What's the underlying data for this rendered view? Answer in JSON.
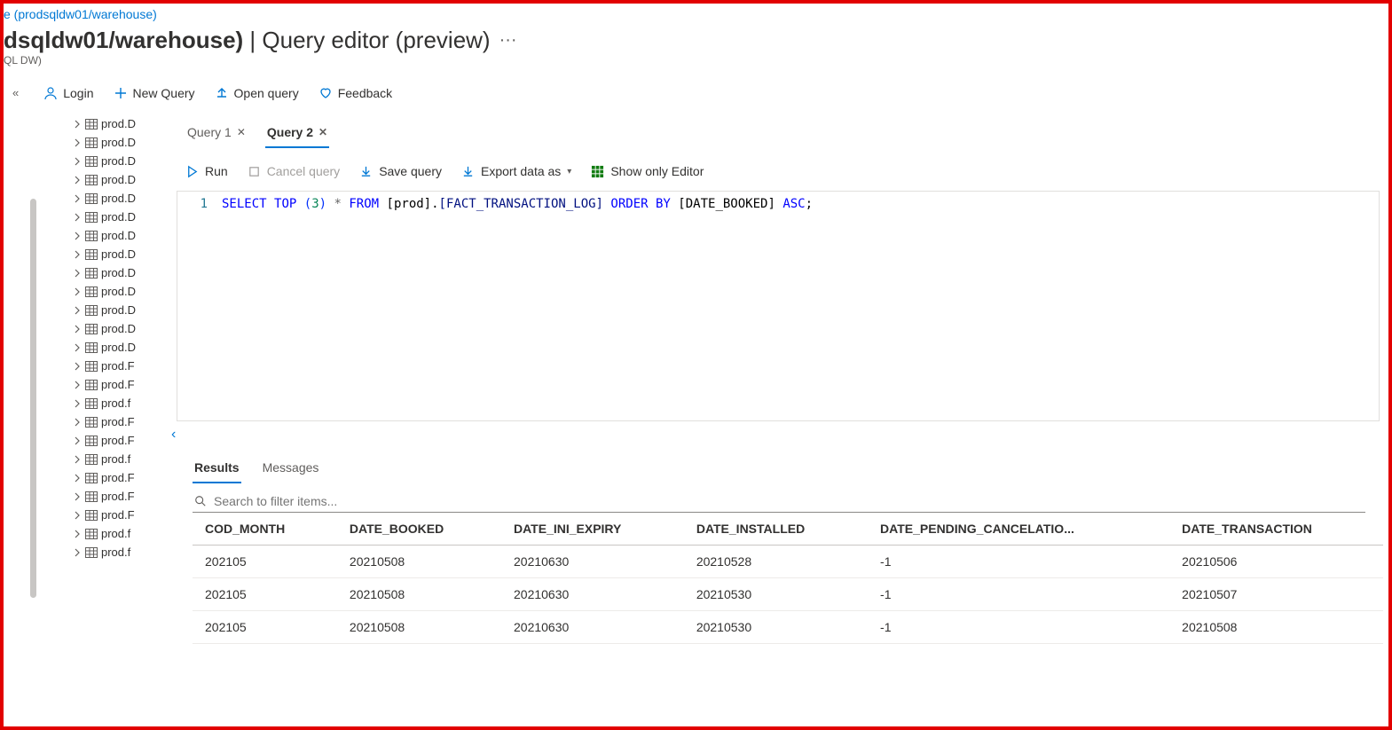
{
  "breadcrumb": {
    "link": "e (prodsqldw01/warehouse)"
  },
  "header": {
    "title_bold": "dsqldw01/warehouse)",
    "title_light": " | Query editor (preview)",
    "subtitle": "QL DW)",
    "more": "···"
  },
  "toolbar": {
    "collapse": "«",
    "login": "Login",
    "new_query": "New Query",
    "open_query": "Open query",
    "feedback": "Feedback"
  },
  "sidebar": {
    "items": [
      "prod.D",
      "prod.D",
      "prod.D",
      "prod.D",
      "prod.D",
      "prod.D",
      "prod.D",
      "prod.D",
      "prod.D",
      "prod.D",
      "prod.D",
      "prod.D",
      "prod.D",
      "prod.F",
      "prod.F",
      "prod.f",
      "prod.F",
      "prod.F",
      "prod.f",
      "prod.F",
      "prod.F",
      "prod.F",
      "prod.f",
      "prod.f"
    ]
  },
  "tabs": [
    {
      "label": "Query 1",
      "active": false
    },
    {
      "label": "Query 2",
      "active": true
    }
  ],
  "query_toolbar": {
    "run": "Run",
    "cancel": "Cancel query",
    "save": "Save query",
    "export": "Export data as",
    "show_editor": "Show only Editor"
  },
  "editor": {
    "line_number": "1",
    "tokens": {
      "select": "SELECT",
      "top": "TOP",
      "lp1": "(",
      "n3": "3",
      "rp1": ")",
      "star": "*",
      "from": "FROM",
      "schema": "[prod]",
      "dot": ".",
      "table": "[FACT_TRANSACTION_LOG]",
      "orderby": "ORDER BY",
      "col": "[DATE_BOOKED]",
      "asc": "ASC",
      "semi": ";"
    }
  },
  "results_panel": {
    "collapse": "‹",
    "tabs": {
      "results": "Results",
      "messages": "Messages"
    },
    "search_placeholder": "Search to filter items...",
    "columns": [
      "COD_MONTH",
      "DATE_BOOKED",
      "DATE_INI_EXPIRY",
      "DATE_INSTALLED",
      "DATE_PENDING_CANCELATIO...",
      "DATE_TRANSACTION"
    ],
    "rows": [
      [
        "202105",
        "20210508",
        "20210630",
        "20210528",
        "-1",
        "20210506"
      ],
      [
        "202105",
        "20210508",
        "20210630",
        "20210530",
        "-1",
        "20210507"
      ],
      [
        "202105",
        "20210508",
        "20210630",
        "20210530",
        "-1",
        "20210508"
      ]
    ]
  }
}
